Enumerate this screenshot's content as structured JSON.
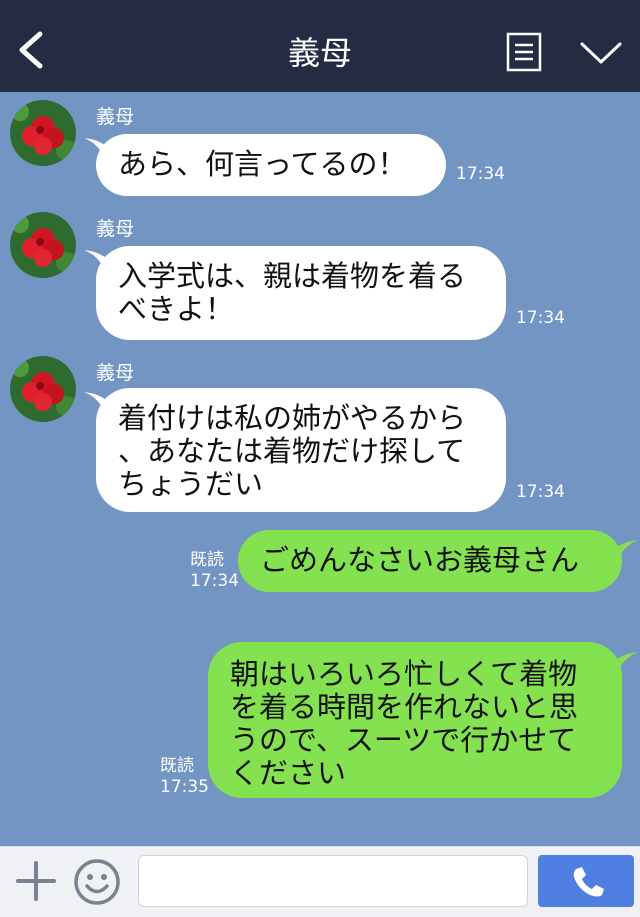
{
  "header": {
    "title": "義母",
    "back_icon": "chevron-left-icon",
    "menu_icon": "list-menu-icon",
    "more_icon": "chevron-down-icon",
    "background": "#232c43"
  },
  "chat": {
    "background": "#7295c4",
    "incoming": [
      {
        "sender": "義母",
        "text": "あら、何言ってるの！",
        "time": "17:34"
      },
      {
        "sender": "義母",
        "text": "入学式は、親は着物を着る\nべきよ！",
        "time": "17:34"
      },
      {
        "sender": "義母",
        "text": "着付けは私の姉がやるから\n、あなたは着物だけ探して\nちょうだい",
        "time": "17:34"
      }
    ],
    "outgoing": [
      {
        "read": "既読",
        "time": "17:34",
        "text": "ごめんなさいお義母さん"
      },
      {
        "read": "既読",
        "time": "17:35",
        "text": "朝はいろいろ忙しくて着物\nを着る時間を作れないと思\nうので、スーツで行かせて\nください"
      }
    ],
    "incoming_bubble_color": "#ffffff",
    "outgoing_bubble_color": "#84e251"
  },
  "footer": {
    "plus_icon": "plus-icon",
    "emoji_icon": "smiley-icon",
    "input_value": "",
    "call_icon": "phone-icon",
    "call_color": "#4f7fe0"
  }
}
